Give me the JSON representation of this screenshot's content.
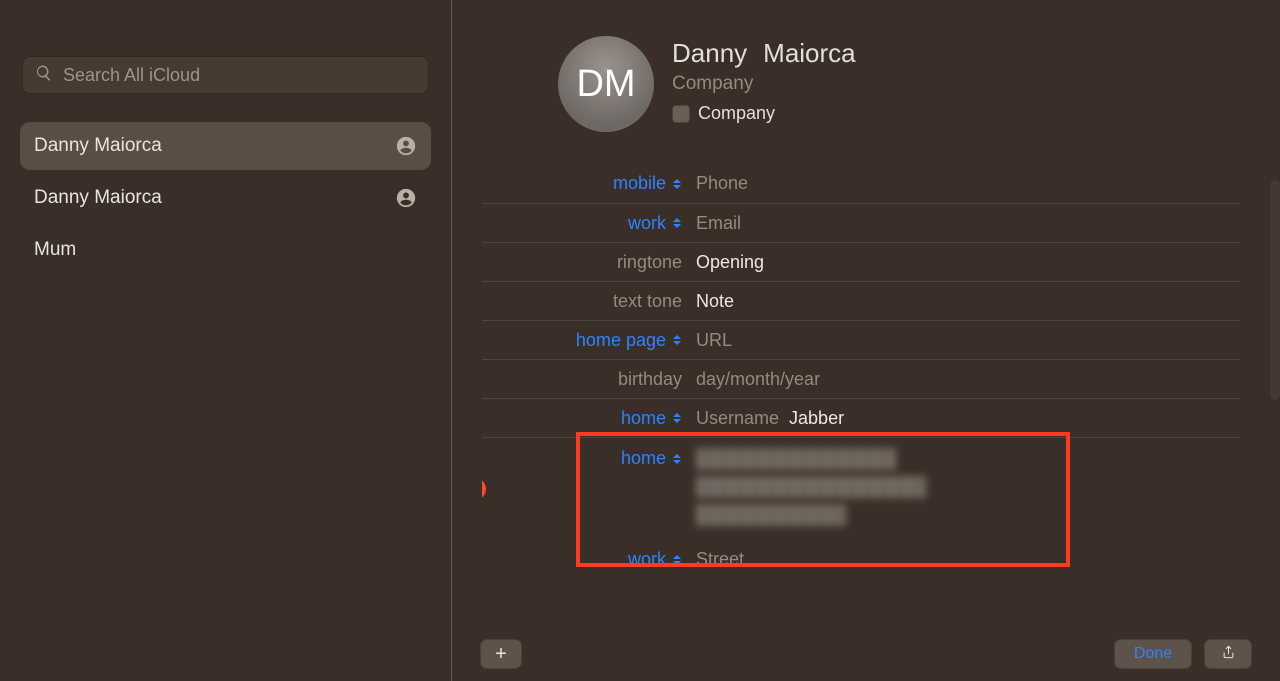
{
  "search": {
    "placeholder": "Search All iCloud"
  },
  "contacts": [
    {
      "name": "Danny  Maiorca",
      "selected": true,
      "has_pic_icon": true
    },
    {
      "name": "Danny Maiorca",
      "selected": false,
      "has_pic_icon": true
    },
    {
      "name": "Mum",
      "selected": false,
      "has_pic_icon": false
    }
  ],
  "card": {
    "avatar_initials": "DM",
    "first_name": "Danny",
    "last_name": "Maiorca",
    "company_placeholder": "Company",
    "company_checkbox_label": "Company",
    "company_checked": false
  },
  "fields": {
    "mobile": {
      "label": "mobile",
      "type": "dropdown_blue",
      "placeholder": "Phone"
    },
    "work_email": {
      "label": "work",
      "type": "dropdown_blue",
      "placeholder": "Email"
    },
    "ringtone": {
      "label": "ringtone",
      "type": "static_gray",
      "value": "Opening"
    },
    "text_tone": {
      "label": "text tone",
      "type": "static_gray",
      "value": "Note"
    },
    "home_page": {
      "label": "home page",
      "type": "dropdown_blue",
      "placeholder": "URL"
    },
    "birthday": {
      "label": "birthday",
      "type": "static_gray_noarrow",
      "placeholder": "day/month/year"
    },
    "username": {
      "label": "home",
      "type": "dropdown_blue",
      "placeholder": "Username",
      "extra_value": "Jabber"
    },
    "address_home": {
      "label": "home",
      "type": "dropdown_blue",
      "redacted_lines": 3,
      "show_delete": true
    },
    "address_work": {
      "label": "work",
      "type": "dropdown_blue",
      "placeholder": "Street"
    }
  },
  "footer": {
    "done": "Done"
  }
}
